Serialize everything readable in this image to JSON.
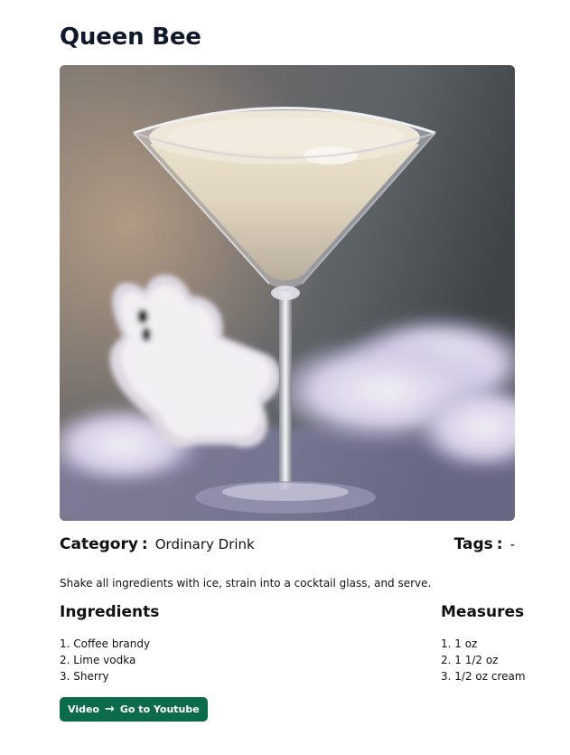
{
  "drink": {
    "name": "Queen Bee",
    "photo_alt": "Queen Bee",
    "category_label": "Category",
    "category_value": "Ordinary Drink",
    "tags_label": "Tags",
    "tags_value": "-",
    "separator": ":",
    "instructions": "Shake all ingredients with ice, strain into a cocktail glass, and serve."
  },
  "ingredients": {
    "heading": "Ingredients",
    "items": [
      "1. Coffee brandy",
      "2. Lime vodka",
      "3. Sherry"
    ]
  },
  "measures": {
    "heading": "Measures",
    "items": [
      "1. 1 oz",
      "2. 1 1/2 oz",
      "3. 1/2 oz cream"
    ]
  },
  "video": {
    "label": "Video",
    "arrow": "→",
    "link_text": "Go to Youtube",
    "arrow_icon": "arrow-right-icon"
  },
  "colors": {
    "title": "#10182b",
    "button_bg": "#0b6b4a",
    "button_text": "#ffffff"
  }
}
